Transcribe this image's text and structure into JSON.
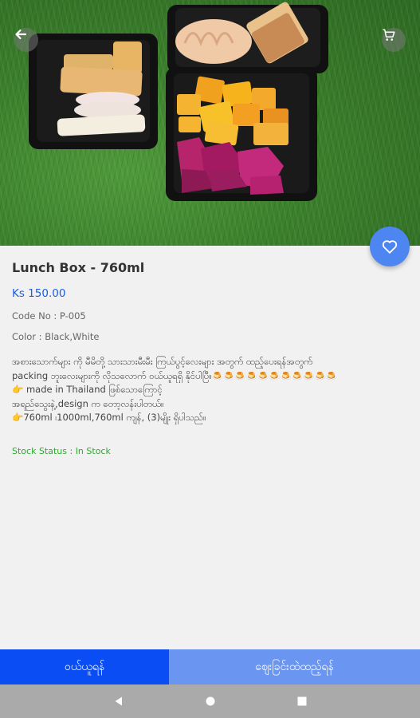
{
  "product": {
    "title": "Lunch Box - 760ml",
    "price": "Ks 150.00",
    "code": "Code No : P-005",
    "color": "Color : Black,White",
    "description_lines": [
      "အစားသောက်များ ကို မီမိတို့ သားသားမီးမီး ကြယ်ပွင့်လေးများ အတွက် ထည့်ပေးရန်အတွက်",
      "packing ဘူးလေးများကို လိုသလောက် ဝယ်ယူရရှိ နိုင်ပါပြီ။🍮🍮🍮🍮🍮🍮🍮🍮🍮🍮🍮",
      "👉 made in Thailand ဖြစ်သောကြောင့်",
      "အရည်သွေးနဲ့,design  က တော့လန်းပါတယ်။",
      "👉760ml ၊1000ml,760ml ကျန်, (3)မျိုး ရှိပါသည်။"
    ],
    "stock_status": "Stock Status : In Stock"
  },
  "actions": {
    "buy_label": "ဝယ်ယူရန်",
    "add_to_cart_label": "ဈေးခြင်းထဲထည့်ရန်"
  },
  "icons": {
    "back": "arrow-left-icon",
    "cart": "shopping-cart-icon",
    "favorite": "heart-icon",
    "nav_back": "triangle-back-icon",
    "nav_home": "circle-home-icon",
    "nav_recent": "square-recent-icon"
  },
  "colors": {
    "accent": "#0a4df5",
    "accent_light": "#6a96f2",
    "fab": "#4d86f0",
    "price": "#1a5ee8",
    "stock": "#2eaa2e"
  }
}
